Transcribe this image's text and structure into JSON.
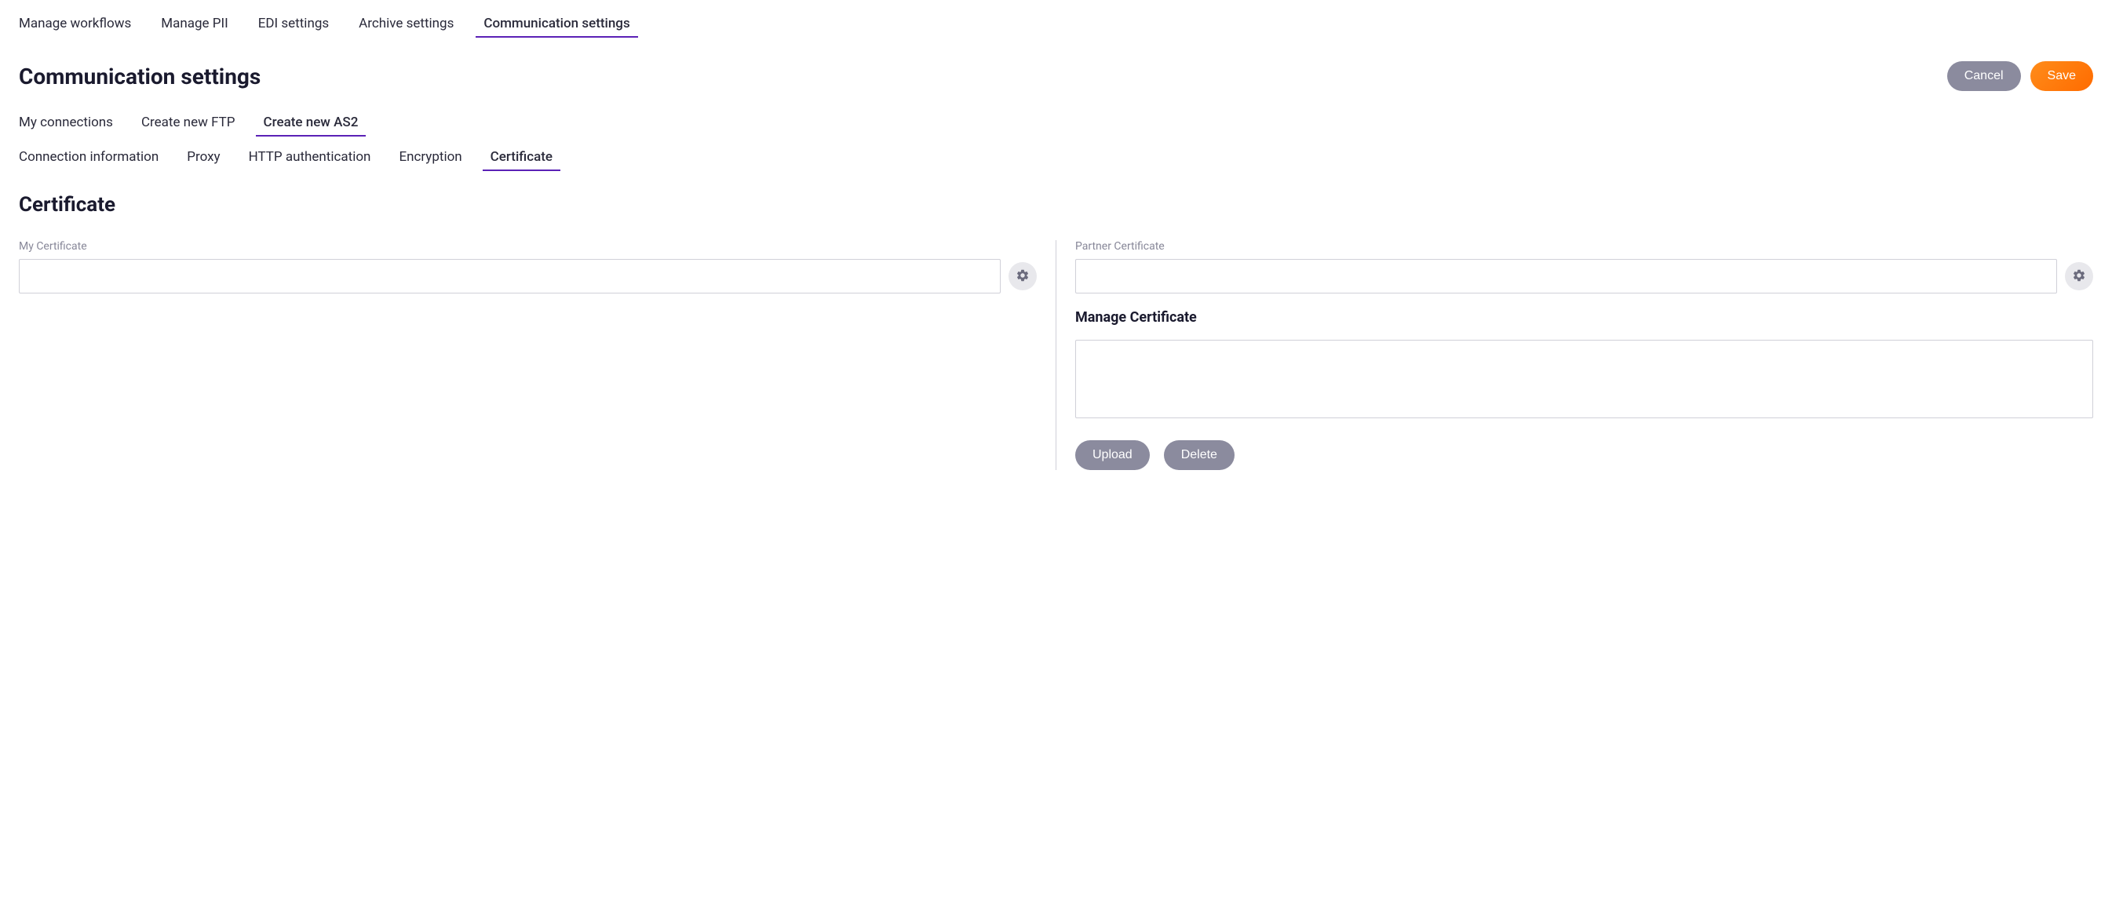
{
  "top_tabs": {
    "items": [
      {
        "label": "Manage workflows"
      },
      {
        "label": "Manage PII"
      },
      {
        "label": "EDI settings"
      },
      {
        "label": "Archive settings"
      },
      {
        "label": "Communication settings"
      }
    ],
    "active_index": 4
  },
  "header": {
    "title": "Communication settings",
    "cancel_label": "Cancel",
    "save_label": "Save"
  },
  "sub_tabs": {
    "items": [
      {
        "label": "My connections"
      },
      {
        "label": "Create new FTP"
      },
      {
        "label": "Create new AS2"
      }
    ],
    "active_index": 2
  },
  "section_tabs": {
    "items": [
      {
        "label": "Connection information"
      },
      {
        "label": "Proxy"
      },
      {
        "label": "HTTP authentication"
      },
      {
        "label": "Encryption"
      },
      {
        "label": "Certificate"
      }
    ],
    "active_index": 4
  },
  "section": {
    "title": "Certificate"
  },
  "my_cert": {
    "label": "My Certificate",
    "value": "",
    "gear_icon": "gear"
  },
  "partner_cert": {
    "label": "Partner Certificate",
    "value": "",
    "gear_icon": "gear"
  },
  "manage_cert": {
    "title": "Manage Certificate",
    "content": "",
    "upload_label": "Upload",
    "delete_label": "Delete"
  }
}
